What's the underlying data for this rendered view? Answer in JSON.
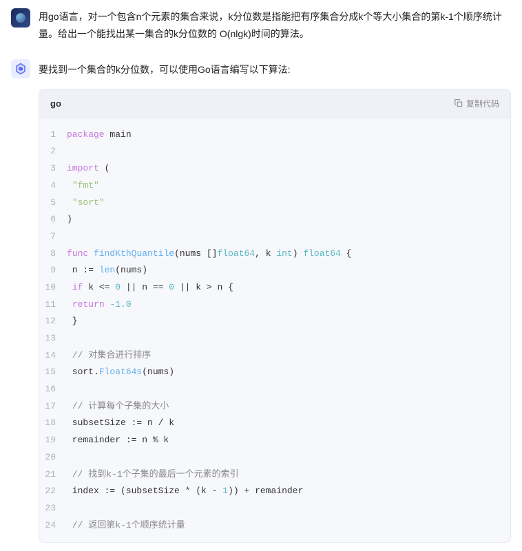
{
  "user_message": "用go语言，对一个包含n个元素的集合来说，k分位数是指能把有序集合分成k个等大小集合的第k-1个顺序统计量。给出一个能找出某一集合的k分位数的 O(nlgk)时间的算法。",
  "ai_intro": "要找到一个集合的k分位数，可以使用Go语言编写以下算法:",
  "code": {
    "lang": "go",
    "copy_label": "复制代码",
    "lines": [
      {
        "n": 1,
        "tokens": [
          {
            "t": "package",
            "c": "kw"
          },
          {
            "t": " main",
            "c": "nm"
          }
        ]
      },
      {
        "n": 2,
        "tokens": []
      },
      {
        "n": 3,
        "tokens": [
          {
            "t": "import",
            "c": "kw"
          },
          {
            "t": " (",
            "c": "nm"
          }
        ]
      },
      {
        "n": 4,
        "tokens": [
          {
            "t": " ",
            "c": ""
          },
          {
            "t": "\"fmt\"",
            "c": "str"
          }
        ]
      },
      {
        "n": 5,
        "tokens": [
          {
            "t": " ",
            "c": ""
          },
          {
            "t": "\"sort\"",
            "c": "str"
          }
        ]
      },
      {
        "n": 6,
        "tokens": [
          {
            "t": ")",
            "c": "nm"
          }
        ]
      },
      {
        "n": 7,
        "tokens": []
      },
      {
        "n": 8,
        "tokens": [
          {
            "t": "func",
            "c": "kw"
          },
          {
            "t": " ",
            "c": ""
          },
          {
            "t": "findKthQuantile",
            "c": "fn"
          },
          {
            "t": "(nums []",
            "c": "nm"
          },
          {
            "t": "float64",
            "c": "type"
          },
          {
            "t": ", k ",
            "c": "nm"
          },
          {
            "t": "int",
            "c": "type"
          },
          {
            "t": ") ",
            "c": "nm"
          },
          {
            "t": "float64",
            "c": "type"
          },
          {
            "t": " {",
            "c": "nm"
          }
        ]
      },
      {
        "n": 9,
        "tokens": [
          {
            "t": " n := ",
            "c": "nm"
          },
          {
            "t": "len",
            "c": "fn"
          },
          {
            "t": "(nums)",
            "c": "nm"
          }
        ]
      },
      {
        "n": 10,
        "tokens": [
          {
            "t": " ",
            "c": ""
          },
          {
            "t": "if",
            "c": "kw"
          },
          {
            "t": " k <= ",
            "c": "nm"
          },
          {
            "t": "0",
            "c": "num"
          },
          {
            "t": " || n == ",
            "c": "nm"
          },
          {
            "t": "0",
            "c": "num"
          },
          {
            "t": " || k > n {",
            "c": "nm"
          }
        ]
      },
      {
        "n": 11,
        "tokens": [
          {
            "t": " ",
            "c": ""
          },
          {
            "t": "return",
            "c": "kw"
          },
          {
            "t": " ",
            "c": ""
          },
          {
            "t": "-1.0",
            "c": "num"
          }
        ]
      },
      {
        "n": 12,
        "tokens": [
          {
            "t": " }",
            "c": "nm"
          }
        ]
      },
      {
        "n": 13,
        "tokens": []
      },
      {
        "n": 14,
        "tokens": [
          {
            "t": " ",
            "c": ""
          },
          {
            "t": "// 对集合进行排序",
            "c": "cm"
          }
        ]
      },
      {
        "n": 15,
        "tokens": [
          {
            "t": " sort.",
            "c": "nm"
          },
          {
            "t": "Float64s",
            "c": "fn"
          },
          {
            "t": "(nums)",
            "c": "nm"
          }
        ]
      },
      {
        "n": 16,
        "tokens": []
      },
      {
        "n": 17,
        "tokens": [
          {
            "t": " ",
            "c": ""
          },
          {
            "t": "// 计算每个子集的大小",
            "c": "cm"
          }
        ]
      },
      {
        "n": 18,
        "tokens": [
          {
            "t": " subsetSize := n / k",
            "c": "nm"
          }
        ]
      },
      {
        "n": 19,
        "tokens": [
          {
            "t": " remainder := n % k",
            "c": "nm"
          }
        ]
      },
      {
        "n": 20,
        "tokens": []
      },
      {
        "n": 21,
        "tokens": [
          {
            "t": " ",
            "c": ""
          },
          {
            "t": "// 找到k-1个子集的最后一个元素的索引",
            "c": "cm"
          }
        ]
      },
      {
        "n": 22,
        "tokens": [
          {
            "t": " index := (subsetSize * (k - ",
            "c": "nm"
          },
          {
            "t": "1",
            "c": "num"
          },
          {
            "t": ")) + remainder",
            "c": "nm"
          }
        ]
      },
      {
        "n": 23,
        "tokens": []
      },
      {
        "n": 24,
        "tokens": [
          {
            "t": " ",
            "c": ""
          },
          {
            "t": "// 返回第k-1个顺序统计量",
            "c": "cm"
          }
        ]
      }
    ]
  }
}
